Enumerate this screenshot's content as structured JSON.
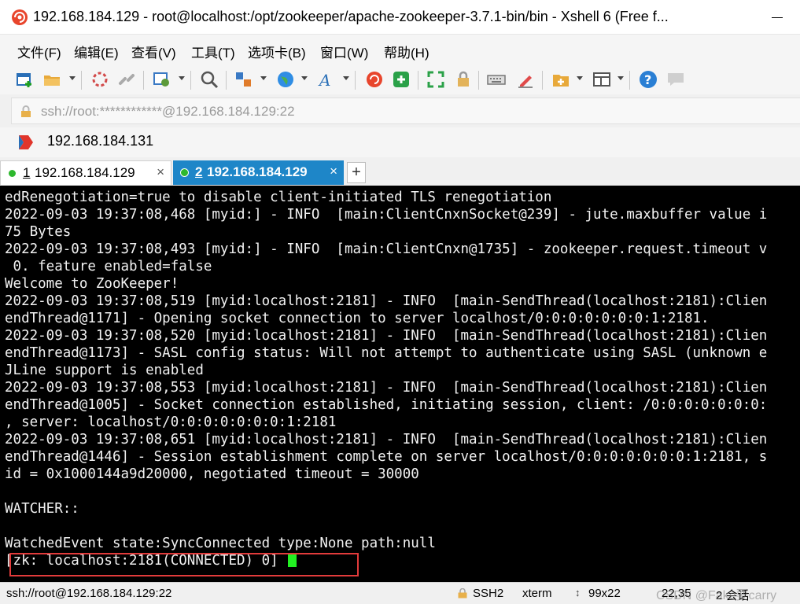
{
  "window": {
    "title": "192.168.184.129 - root@localhost:/opt/zookeeper/apache-zookeeper-3.7.1-bin/bin - Xshell 6 (Free f..."
  },
  "menu": {
    "items": [
      "文件(F)",
      "编辑(E)",
      "查看(V)",
      "工具(T)",
      "选项卡(B)",
      "窗口(W)",
      "帮助(H)"
    ]
  },
  "toolbar": {
    "icons": [
      "new-session-icon",
      "open-folder-icon",
      "connect-icon",
      "disconnect-icon",
      "properties-icon",
      "find-icon",
      "transfer-icon",
      "globe-icon",
      "font-icon",
      "xshell-icon",
      "xftp-icon",
      "fullscreen-icon",
      "lock-icon",
      "keyboard-icon",
      "highlight-icon",
      "new-tab-folder-icon",
      "layout-icon",
      "help-icon",
      "chat-icon"
    ]
  },
  "address": {
    "value": "ssh://root:************@192.168.184.129:22"
  },
  "quick": {
    "label": "192.168.184.131"
  },
  "tabs": [
    {
      "number": "1",
      "label": "192.168.184.129",
      "close": "×",
      "active": false
    },
    {
      "number": "2",
      "label": "192.168.184.129",
      "close": "×",
      "active": true
    }
  ],
  "new_tab": "+",
  "terminal": {
    "lines": [
      "edRenegotiation=true to disable client-initiated TLS renegotiation",
      "2022-09-03 19:37:08,468 [myid:] - INFO  [main:ClientCnxnSocket@239] - jute.maxbuffer value i",
      "75 Bytes",
      "2022-09-03 19:37:08,493 [myid:] - INFO  [main:ClientCnxn@1735] - zookeeper.request.timeout v",
      " 0. feature enabled=false",
      "Welcome to ZooKeeper!",
      "2022-09-03 19:37:08,519 [myid:localhost:2181] - INFO  [main-SendThread(localhost:2181):Clien",
      "endThread@1171] - Opening socket connection to server localhost/0:0:0:0:0:0:0:1:2181.",
      "2022-09-03 19:37:08,520 [myid:localhost:2181] - INFO  [main-SendThread(localhost:2181):Clien",
      "endThread@1173] - SASL config status: Will not attempt to authenticate using SASL (unknown e",
      "JLine support is enabled",
      "2022-09-03 19:37:08,553 [myid:localhost:2181] - INFO  [main-SendThread(localhost:2181):Clien",
      "endThread@1005] - Socket connection established, initiating session, client: /0:0:0:0:0:0:0:",
      ", server: localhost/0:0:0:0:0:0:0:1:2181",
      "2022-09-03 19:37:08,651 [myid:localhost:2181] - INFO  [main-SendThread(localhost:2181):Clien",
      "endThread@1446] - Session establishment complete on server localhost/0:0:0:0:0:0:0:1:2181, s",
      "id = 0x1000144a9d20000, negotiated timeout = 30000",
      "",
      "WATCHER::",
      "",
      "WatchedEvent state:SyncConnected type:None path:null"
    ],
    "prompt": "[zk: localhost:2181(CONNECTED) 0] "
  },
  "status": {
    "connection": "ssh://root@192.168.184.129:22",
    "protocol": "SSH2",
    "terminal_type": "xterm",
    "size": "99x22",
    "position": "22,35",
    "sessions": "2 会话",
    "watermark": "CSDN @Fake要carry"
  },
  "colors": {
    "terminal_bg": "#000000",
    "terminal_fg": "#f2f2f2",
    "cursor": "#22f022",
    "active_tab": "#1e86c8",
    "highlight_box": "#e23b3b"
  }
}
